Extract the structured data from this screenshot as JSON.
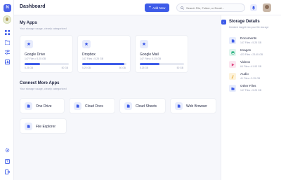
{
  "header": {
    "title": "Dashboard",
    "add_label": "Add New",
    "search_placeholder": "Search File, Folder, or Email..."
  },
  "my_apps": {
    "title": "My Apps",
    "subtitle": "Your storage usage, clearly categorized",
    "apps": [
      {
        "name": "Google Drive",
        "meta": "147 Files  •  5.25 GB",
        "used": "5.25 GB",
        "total": "50 GB",
        "progress": 0.35
      },
      {
        "name": "Dropbox",
        "meta": "147 Files  •  5.25 GB",
        "used": "5.25 GB",
        "total": "50 GB",
        "progress": 0.95
      },
      {
        "name": "Google Mail",
        "meta": "147 Files  •  5.25 GB",
        "used": "5.25 GB",
        "total": "50 GB",
        "progress": 0.45
      }
    ]
  },
  "connect": {
    "title": "Connect More Apps",
    "subtitle": "Your storage usage, clearly categorized",
    "apps": [
      {
        "label": "One Drive"
      },
      {
        "label": "Cloud Docs"
      },
      {
        "label": "Cloud Sheets"
      },
      {
        "label": "Web Browser"
      },
      {
        "label": "File Explorer"
      }
    ]
  },
  "storage": {
    "title": "Storage Details",
    "subtitle": "Detailed insight into your file storage",
    "items": [
      {
        "name": "Documents",
        "meta": "147 Files  •  5.25 GB",
        "icon": "document-icon",
        "bg": "#e7ecfc",
        "color": "#3d5be8"
      },
      {
        "name": "Images",
        "meta": "423 Files  •  23.45 GB",
        "icon": "image-icon",
        "bg": "#e3f6ef",
        "color": "#28b27e"
      },
      {
        "name": "Videos",
        "meta": "64 Files  •  41.93 GB",
        "icon": "video-icon",
        "bg": "#fbe6f0",
        "color": "#e0437e"
      },
      {
        "name": "Audio",
        "meta": "41 Files  •  3.25 GB",
        "icon": "audio-icon",
        "bg": "#fdf3dc",
        "color": "#e6a21a"
      },
      {
        "name": "Other Files",
        "meta": "147 Files  •  5.25 GB",
        "icon": "folder-icon",
        "bg": "#e7ecfc",
        "color": "#3d5be8"
      }
    ]
  },
  "colors": {
    "accent": "#3d5be8",
    "background": "#f6f7fb"
  }
}
